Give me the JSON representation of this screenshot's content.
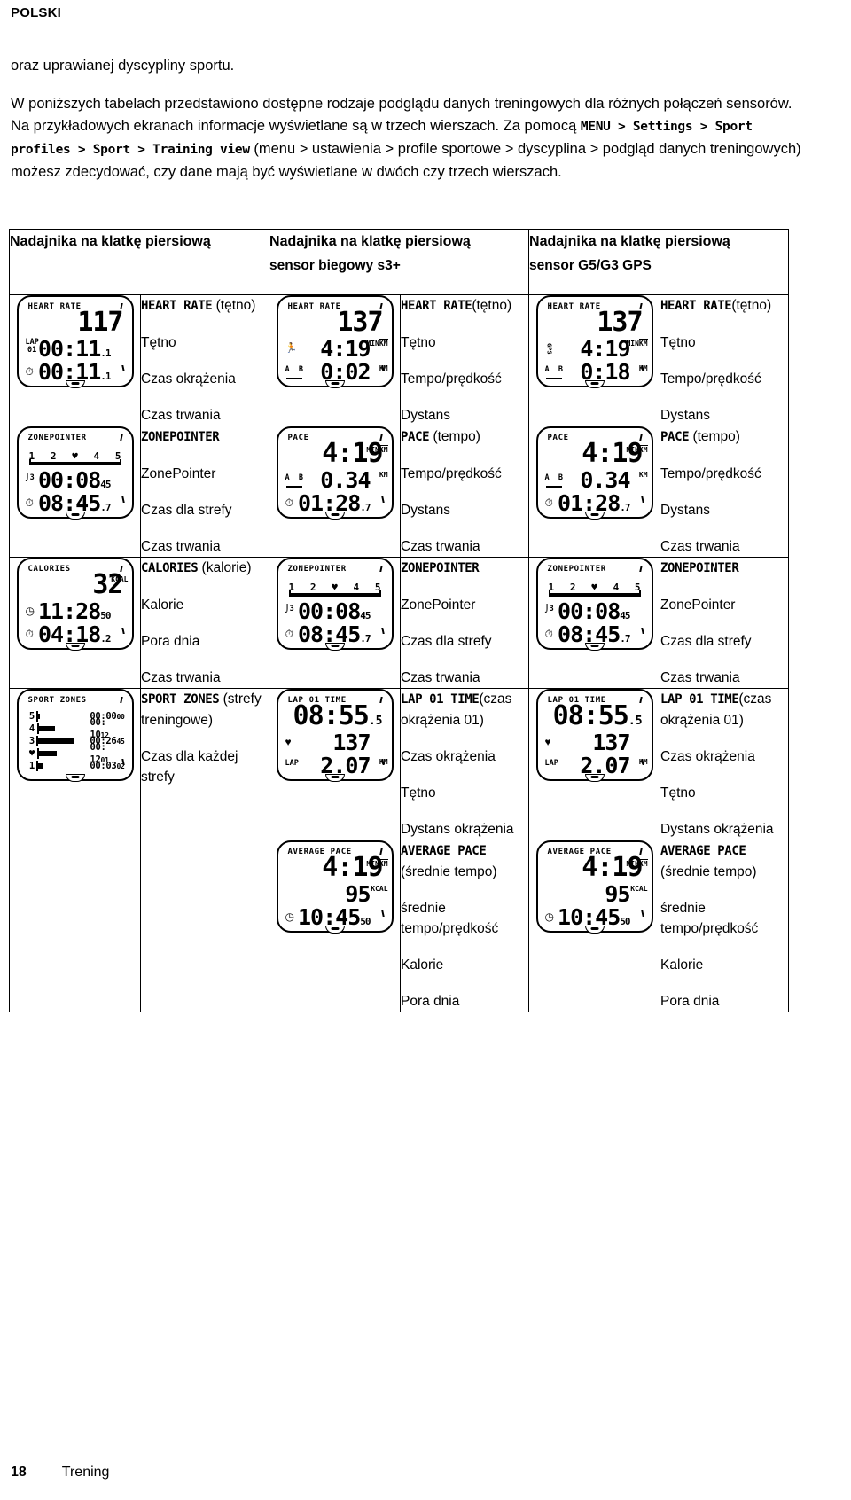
{
  "header": {
    "language": "POLSKI"
  },
  "intro": {
    "line1": "oraz uprawianej dyscypliny sportu.",
    "para2_a": "W poniższych tabelach przedstawiono dostępne rodzaje podglądu danych treningowych dla różnych połączeń sensorów. Na przykładowych ekranach informacje wyświetlane są w trzech wierszach. Za pomocą ",
    "para2_path": "MENU > Settings > Sport profiles > Sport > Training view",
    "para2_b": " (menu > ustawienia > profile sportowe > dyscyplina > podgląd danych treningowych) możesz zdecydować, czy dane mają być wyświetlane w dwóch czy trzech wierszach."
  },
  "table": {
    "headers": [
      {
        "title": "Nadajnika na klatkę piersiową",
        "subtitle": ""
      },
      {
        "title": "Nadajnika na klatkę piersiową",
        "subtitle": "sensor biegowy s3+"
      },
      {
        "title": "Nadajnika na klatkę piersiową",
        "subtitle": "sensor G5/G3 GPS"
      }
    ],
    "rows": [
      {
        "col1": {
          "screen": {
            "title": "HEART RATE",
            "row1": "117",
            "row2": "00:11",
            "row2_dec": ".1",
            "row2_label": "LAP 01",
            "row3": "00:11",
            "row3_dec": ".1",
            "row3_icon": "stopwatch-icon"
          },
          "labels": [
            {
              "mono": "HEART RATE",
              "plain": " (tętno)"
            },
            {
              "mono": "",
              "plain": "Tętno"
            },
            {
              "mono": "",
              "plain": "Czas okrążenia"
            },
            {
              "mono": "",
              "plain": "Czas trwania"
            }
          ]
        },
        "col2": {
          "screen": {
            "title": "HEART RATE",
            "row1": "137",
            "row2": "4:19",
            "row2_unit_num": "MIN",
            "row2_unit_den": "KM",
            "row2_icon": "runner-icon",
            "row3": "0:02",
            "row3_unit": "KM",
            "row3_icon": "lap-distance-icon"
          },
          "labels": [
            {
              "mono": "HEART RATE",
              "plain": "(tętno)"
            },
            {
              "mono": "",
              "plain": "Tętno"
            },
            {
              "mono": "",
              "plain": "Tempo/prędkość"
            },
            {
              "mono": "",
              "plain": "Dystans"
            }
          ]
        },
        "col3": {
          "screen": {
            "title": "HEART RATE",
            "row1": "137",
            "row2": "4:19",
            "row2_unit_num": "MIN",
            "row2_unit_den": "KM",
            "row2_icon": "gps-icon",
            "row3": "0:18",
            "row3_unit": "KM",
            "row3_icon": "lap-distance-icon"
          },
          "labels": [
            {
              "mono": "HEART RATE",
              "plain": "(tętno)"
            },
            {
              "mono": "",
              "plain": "Tętno"
            },
            {
              "mono": "",
              "plain": "Tempo/prędkość"
            },
            {
              "mono": "",
              "plain": "Dystans"
            }
          ]
        }
      },
      {
        "col1": {
          "screen": {
            "title": "ZONEPOINTER",
            "zones": [
              "1",
              "2",
              "♥",
              "4",
              "5"
            ],
            "row2": "00:08",
            "row2_dec": "45",
            "row2_icon": "zone-icon",
            "row3": "08:45",
            "row3_dec": ".7",
            "row3_icon": "stopwatch-icon"
          },
          "labels": [
            {
              "mono": "ZONEPOINTER",
              "plain": ""
            },
            {
              "mono": "",
              "plain": "ZonePointer"
            },
            {
              "mono": "",
              "plain": "Czas dla strefy"
            },
            {
              "mono": "",
              "plain": "Czas trwania"
            }
          ]
        },
        "col2": {
          "screen": {
            "title": "PACE",
            "row1": "4:19",
            "row1_unit_num": "MIN",
            "row1_unit_den": "KM",
            "row2": "0.34",
            "row2_unit": "KM",
            "row2_icon": "lap-distance-icon",
            "row3": "01:28",
            "row3_dec": ".7",
            "row3_icon": "stopwatch-icon"
          },
          "labels": [
            {
              "mono": "PACE",
              "plain": " (tempo)"
            },
            {
              "mono": "",
              "plain": "Tempo/prędkość"
            },
            {
              "mono": "",
              "plain": "Dystans"
            },
            {
              "mono": "",
              "plain": "Czas trwania"
            }
          ]
        },
        "col3": {
          "screen": {
            "title": "PACE",
            "row1": "4:19",
            "row1_unit_num": "MIN",
            "row1_unit_den": "KM",
            "row2": "0.34",
            "row2_unit": "KM",
            "row2_icon": "lap-distance-icon",
            "row3": "01:28",
            "row3_dec": ".7",
            "row3_icon": "stopwatch-icon"
          },
          "labels": [
            {
              "mono": "PACE",
              "plain": " (tempo)"
            },
            {
              "mono": "",
              "plain": "Tempo/prędkość"
            },
            {
              "mono": "",
              "plain": "Dystans"
            },
            {
              "mono": "",
              "plain": "Czas trwania"
            }
          ]
        }
      },
      {
        "col1": {
          "screen": {
            "title": "CALORIES",
            "row1": "32",
            "row1_unit": "KCAL",
            "row2": "11:28",
            "row2_dec": "50",
            "row2_icon": "clock-icon",
            "row3": "04:18",
            "row3_dec": ".2",
            "row3_icon": "stopwatch-icon"
          },
          "labels": [
            {
              "mono": "CALORIES",
              "plain": " (kalorie)"
            },
            {
              "mono": "",
              "plain": "Kalorie"
            },
            {
              "mono": "",
              "plain": "Pora dnia"
            },
            {
              "mono": "",
              "plain": "Czas trwania"
            }
          ]
        },
        "col2": {
          "screen": {
            "title": "ZONEPOINTER",
            "zones": [
              "1",
              "2",
              "♥",
              "4",
              "5"
            ],
            "row2": "00:08",
            "row2_dec": "45",
            "row2_icon": "zone-icon",
            "row3": "08:45",
            "row3_dec": ".7",
            "row3_icon": "stopwatch-icon"
          },
          "labels": [
            {
              "mono": "ZONEPOINTER",
              "plain": ""
            },
            {
              "mono": "",
              "plain": "ZonePointer"
            },
            {
              "mono": "",
              "plain": "Czas dla strefy"
            },
            {
              "mono": "",
              "plain": "Czas trwania"
            }
          ]
        },
        "col3": {
          "screen": {
            "title": "ZONEPOINTER",
            "zones": [
              "1",
              "2",
              "♥",
              "4",
              "5"
            ],
            "row2": "00:08",
            "row2_dec": "45",
            "row2_icon": "zone-icon",
            "row3": "08:45",
            "row3_dec": ".7",
            "row3_icon": "stopwatch-icon"
          },
          "labels": [
            {
              "mono": "ZONEPOINTER",
              "plain": ""
            },
            {
              "mono": "",
              "plain": "ZonePointer"
            },
            {
              "mono": "",
              "plain": "Czas dla strefy"
            },
            {
              "mono": "",
              "plain": "Czas trwania"
            }
          ]
        }
      },
      {
        "col1": {
          "screen": {
            "title": "SPORT ZONES",
            "zone_rows": [
              {
                "label": "5",
                "time": "00:00",
                "dec": "00",
                "fill": 2
              },
              {
                "label": "4",
                "time": "00: 10",
                "dec": "12",
                "fill": 18
              },
              {
                "label": "3",
                "time": "00:26",
                "dec": "45",
                "fill": 40
              },
              {
                "label": "♥",
                "time": "00: 12",
                "dec": "01",
                "fill": 20
              },
              {
                "label": "1",
                "time": "00:03",
                "dec": "02",
                "fill": 5
              }
            ]
          },
          "labels": [
            {
              "mono": "SPORT ZONES",
              "plain": " (strefy treningowe)"
            },
            {
              "mono": "",
              "plain": "Czas dla każdej strefy"
            }
          ]
        },
        "col2": {
          "screen": {
            "title": "LAP 01 TIME",
            "row1": "08:55",
            "row1_dec": ".5",
            "row2": "137",
            "row2_icon": "heart-icon",
            "row3": "2.07",
            "row3_unit": "KM",
            "row3_icon": "lap-icon"
          },
          "labels": [
            {
              "mono": "LAP 01 TIME",
              "plain": "(czas okrążenia 01)"
            },
            {
              "mono": "",
              "plain": "Czas okrążenia"
            },
            {
              "mono": "",
              "plain": "Tętno"
            },
            {
              "mono": "",
              "plain": "Dystans okrążenia"
            }
          ]
        },
        "col3": {
          "screen": {
            "title": "LAP 01 TIME",
            "row1": "08:55",
            "row1_dec": ".5",
            "row2": "137",
            "row2_icon": "heart-icon",
            "row3": "2.07",
            "row3_unit": "KM",
            "row3_icon": "lap-icon"
          },
          "labels": [
            {
              "mono": "LAP 01 TIME",
              "plain": "(czas okrążenia 01)"
            },
            {
              "mono": "",
              "plain": "Czas okrążenia"
            },
            {
              "mono": "",
              "plain": "Tętno"
            },
            {
              "mono": "",
              "plain": "Dystans okrążenia"
            }
          ]
        }
      },
      {
        "col1": {
          "screen": null,
          "labels": []
        },
        "col2": {
          "screen": {
            "title": "AVERAGE PACE",
            "row1": "4:19",
            "row1_unit_num": "MIN",
            "row1_unit_den": "KM",
            "row2": "95",
            "row2_unit": "KCAL",
            "row3": "10:45",
            "row3_dec": "50",
            "row3_icon": "clock-icon"
          },
          "labels": [
            {
              "mono": "AVERAGE PACE",
              "plain": " (średnie tempo)"
            },
            {
              "mono": "",
              "plain": "średnie tempo/prędkość"
            },
            {
              "mono": "",
              "plain": "Kalorie"
            },
            {
              "mono": "",
              "plain": "Pora dnia"
            }
          ]
        },
        "col3": {
          "screen": {
            "title": "AVERAGE PACE",
            "row1": "4:19",
            "row1_unit_num": "MIN",
            "row1_unit_den": "KM",
            "row2": "95",
            "row2_unit": "KCAL",
            "row3": "10:45",
            "row3_dec": "50",
            "row3_icon": "clock-icon"
          },
          "labels": [
            {
              "mono": "AVERAGE PACE",
              "plain": " (średnie tempo)"
            },
            {
              "mono": "",
              "plain": "średnie tempo/prędkość"
            },
            {
              "mono": "",
              "plain": "Kalorie"
            },
            {
              "mono": "",
              "plain": "Pora dnia"
            }
          ]
        }
      }
    ]
  },
  "footer": {
    "page_number": "18",
    "section": "Trening"
  }
}
